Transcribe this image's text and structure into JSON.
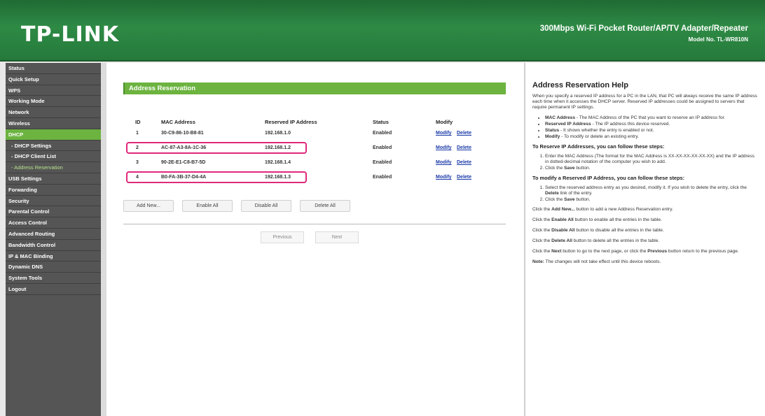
{
  "header": {
    "logo": "TP-LINK",
    "product": "300Mbps Wi-Fi Pocket Router/AP/TV Adapter/Repeater",
    "model": "Model No. TL-WR810N",
    "colors": {
      "header_green": "#2e8a45",
      "accent_green": "#6cb33f",
      "highlight_pink": "#e0287a"
    }
  },
  "sidebar": {
    "items": [
      {
        "label": "Status"
      },
      {
        "label": "Quick Setup"
      },
      {
        "label": "WPS"
      },
      {
        "label": "Working Mode"
      },
      {
        "label": "Network"
      },
      {
        "label": "Wireless"
      },
      {
        "label": "DHCP"
      },
      {
        "label": "- DHCP Settings"
      },
      {
        "label": "- DHCP Client List"
      },
      {
        "label": "- Address Reservation"
      },
      {
        "label": "USB Settings"
      },
      {
        "label": "Forwarding"
      },
      {
        "label": "Security"
      },
      {
        "label": "Parental Control"
      },
      {
        "label": "Access Control"
      },
      {
        "label": "Advanced Routing"
      },
      {
        "label": "Bandwidth Control"
      },
      {
        "label": "IP & MAC Binding"
      },
      {
        "label": "Dynamic DNS"
      },
      {
        "label": "System Tools"
      },
      {
        "label": "Logout"
      }
    ]
  },
  "main": {
    "section_title": "Address Reservation",
    "columns": [
      "ID",
      "MAC Address",
      "Reserved IP Address",
      "Status",
      "Modify"
    ],
    "rows": [
      {
        "id": "1",
        "mac": "30-C9-86-10-B8-81",
        "ip": "192.168.1.0",
        "status": "Enabled",
        "modify": "Modify",
        "delete": "Delete"
      },
      {
        "id": "2",
        "mac": "AC-87-A3-8A-1C-36",
        "ip": "192.168.1.2",
        "status": "Enabled",
        "modify": "Modify",
        "delete": "Delete"
      },
      {
        "id": "3",
        "mac": "90-2E-E1-C8-B7-5D",
        "ip": "192.168.1.4",
        "status": "Enabled",
        "modify": "Modify",
        "delete": "Delete"
      },
      {
        "id": "4",
        "mac": "B0-FA-3B-37-D4-4A",
        "ip": "192.168.1.3",
        "status": "Enabled",
        "modify": "Modify",
        "delete": "Delete"
      }
    ],
    "buttons": {
      "add_new": "Add New...",
      "enable_all": "Enable All",
      "disable_all": "Disable All",
      "delete_all": "Delete All",
      "previous": "Previous",
      "next": "Next"
    }
  },
  "help": {
    "title": "Address Reservation Help",
    "intro": "When you specify a reserved IP address for a PC in the LAN, that PC will always receive the same IP address each time when it accesses the DHCP server. Reserved IP addresses could be assigned to servers that require permanent IP settings.",
    "defs": [
      {
        "term": "MAC Address",
        "desc": " - The MAC Address of the PC that you want to reserve an IP address for."
      },
      {
        "term": "Reserved IP Address",
        "desc": " - The IP address this device reserved."
      },
      {
        "term": "Status",
        "desc": " - It shows whether the entry is enabled or not."
      },
      {
        "term": "Modify",
        "desc": " - To modify or delete an existing entry."
      }
    ],
    "reserve_heading": "To Reserve IP Addresses, you can follow these steps:",
    "reserve_step1": "Enter the MAC Address (The format for the MAC Address is XX-XX-XX-XX-XX-XX) and the IP address in dotted-decimal notation of the computer you wish to add.",
    "reserve_step2_pre": "Click the ",
    "reserve_step2_b": "Save",
    "reserve_step2_post": " button.",
    "modify_heading": "To modify a Reserved IP Address, you can follow these steps:",
    "modify_step1_pre": "Select the reserved address entry as you desired, modify it. If you wish to delete the entry, click the ",
    "modify_step1_b": "Delete",
    "modify_step1_post": " link of the entry.",
    "modify_step2_pre": "Click the ",
    "modify_step2_b": "Save",
    "modify_step2_post": " button.",
    "p_add_pre": "Click the ",
    "p_add_b": "Add New...",
    "p_add_post": " button to add a new Address Reservation entry.",
    "p_enable_pre": "Click the ",
    "p_enable_b": "Enable All",
    "p_enable_post": " button to enable all the entries in the table.",
    "p_disable_pre": "Click the ",
    "p_disable_b": "Disable All",
    "p_disable_post": " button to disable all the entries in the table.",
    "p_delete_pre": "Click the ",
    "p_delete_b": "Delete All",
    "p_delete_post": " button to delete all the entries in the table.",
    "p_next_pre": "Click the ",
    "p_next_b": "Next",
    "p_next_mid": " button to go to the next page, or click the ",
    "p_next_b2": "Previous",
    "p_next_post": " button return to the previous page.",
    "note_b": "Note:",
    "note_text": " The changes will not take effect until this device reboots."
  }
}
